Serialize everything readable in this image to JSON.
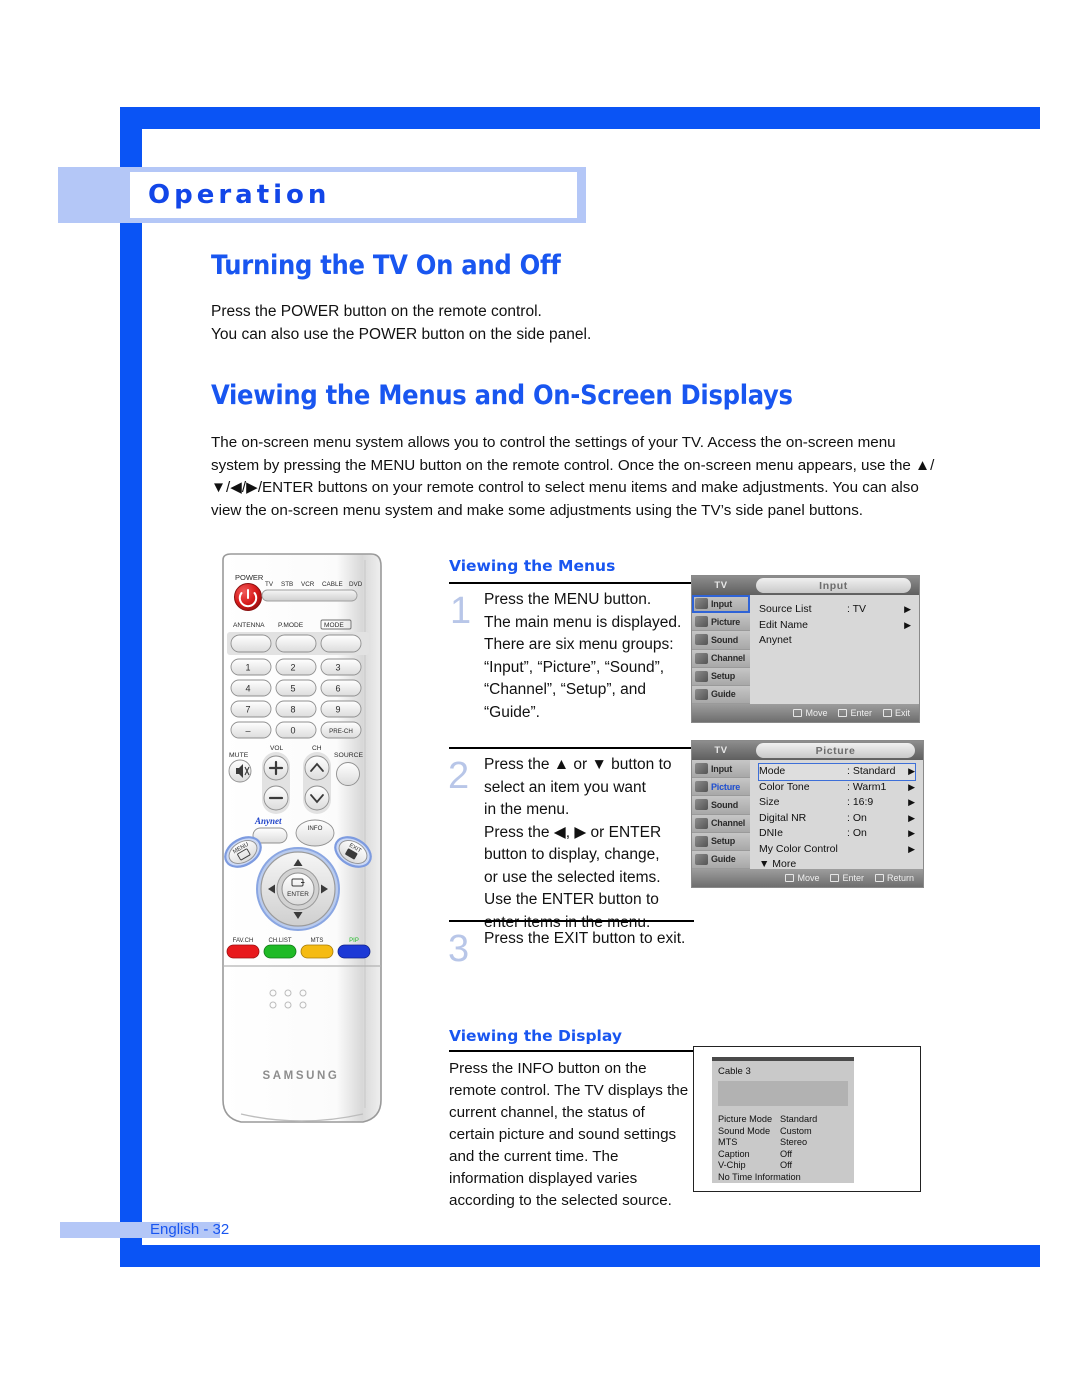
{
  "chapter": {
    "title": "Operation"
  },
  "sections": {
    "turning_on_off": {
      "heading": "Turning the TV On and Off",
      "body": "Press the POWER button on the remote control.\nYou can also use the POWER button on the side panel."
    },
    "viewing_menus_osd": {
      "heading": "Viewing the Menus and On-Screen Displays",
      "body": "The on-screen menu system allows you to control the settings of your TV. Access the on-screen menu system by pressing the MENU button on the remote control. Once the on-screen menu appears, use the ▲/▼/◀/▶/ENTER buttons on your remote control to select menu items and make adjustments. You can also view the on-screen menu system and make some adjustments using the TV’s side panel buttons."
    }
  },
  "viewing_the_menus": {
    "subheading": "Viewing the Menus",
    "steps": [
      {
        "number": "1",
        "text": "Press the MENU button.\nThe main menu is displayed.\nThere are six menu groups:\n“Input”, “Picture”, “Sound”,\n“Channel”, “Setup”, and\n“Guide”."
      },
      {
        "number": "2",
        "text": "Press the ▲ or ▼ button to\nselect an item you want\nin the menu.\nPress the ◀, ▶ or ENTER\nbutton to display, change,\nor use the selected items.\nUse the ENTER button to\nenter items in the menu."
      },
      {
        "number": "3",
        "text": "Press the EXIT button to exit."
      }
    ]
  },
  "viewing_the_display": {
    "subheading": "Viewing the Display",
    "text": "Press the INFO button on the remote control.\nThe TV displays the current channel, the status of certain picture and sound settings and the current time.\nThe information displayed varies according to the selected source."
  },
  "osd_input": {
    "source_label": "TV",
    "title": "Input",
    "nav": [
      "Input",
      "Picture",
      "Sound",
      "Channel",
      "Setup",
      "Guide"
    ],
    "selected_nav": "Input",
    "rows": [
      {
        "key": "Source List",
        "value": ": TV",
        "arrow": "▶"
      },
      {
        "key": "Edit Name",
        "value": "",
        "arrow": "▶"
      },
      {
        "key": "Anynet",
        "value": "",
        "arrow": ""
      }
    ],
    "footer": [
      {
        "icon": "updown-icon",
        "label": "Move"
      },
      {
        "icon": "enter-icon",
        "label": "Enter"
      },
      {
        "icon": "menu-icon",
        "label": "Exit"
      }
    ]
  },
  "osd_picture": {
    "source_label": "TV",
    "title": "Picture",
    "nav": [
      "Input",
      "Picture",
      "Sound",
      "Channel",
      "Setup",
      "Guide"
    ],
    "selected_nav": "Picture",
    "rows": [
      {
        "key": "Mode",
        "value": ": Standard",
        "arrow": "▶",
        "highlight": true
      },
      {
        "key": "Color Tone",
        "value": ": Warm1",
        "arrow": "▶"
      },
      {
        "key": "Size",
        "value": ": 16:9",
        "arrow": "▶"
      },
      {
        "key": "Digital NR",
        "value": ": On",
        "arrow": "▶"
      },
      {
        "key": "DNIe",
        "value": ": On",
        "arrow": "▶"
      },
      {
        "key": "My Color Control",
        "value": "",
        "arrow": "▶"
      },
      {
        "key": "▼ More",
        "value": "",
        "arrow": ""
      }
    ],
    "footer": [
      {
        "icon": "updown-icon",
        "label": "Move"
      },
      {
        "icon": "enter-icon",
        "label": "Enter"
      },
      {
        "icon": "menu-icon",
        "label": "Return"
      }
    ]
  },
  "info_display": {
    "channel": "Cable 3",
    "rows": [
      {
        "key": "Picture Mode",
        "value": "Standard"
      },
      {
        "key": "Sound Mode",
        "value": "Custom"
      },
      {
        "key": "MTS",
        "value": "Stereo"
      },
      {
        "key": "Caption",
        "value": "Off"
      },
      {
        "key": "V-Chip",
        "value": "Off"
      }
    ],
    "time_note": "No Time Information"
  },
  "remote": {
    "brand": "SAMSUNG",
    "power_label": "POWER",
    "mode_row": [
      "TV",
      "STB",
      "VCR",
      "CABLE",
      "DVD"
    ],
    "top_buttons": [
      "ANTENNA",
      "P.MODE",
      "MODE"
    ],
    "keypad": [
      "1",
      "2",
      "3",
      "4",
      "5",
      "6",
      "7",
      "8",
      "9",
      "–",
      "0",
      "PRE-CH"
    ],
    "vol_label": "VOL",
    "ch_label": "CH",
    "mute_label": "MUTE",
    "source_label": "SOURCE",
    "anynet_label": "Anynet",
    "info_label": "INFO",
    "menu_label": "MENU",
    "exit_label": "EXIT",
    "enter_label": "ENTER",
    "color_buttons": [
      {
        "label": "FAV.CH",
        "color": "#e8191c"
      },
      {
        "label": "CH.LIST",
        "color": "#1fba26"
      },
      {
        "label": "MTS",
        "color": "#f5bb12"
      },
      {
        "label": "PIP",
        "color": "#1c39d6"
      }
    ]
  },
  "footer": {
    "page_label": "English - 32"
  },
  "colors": {
    "brand_blue": "#0a54f5",
    "heading_blue": "#1956f0",
    "band_blue": "#b4c7f7",
    "step_number": "#b8c6e8"
  }
}
